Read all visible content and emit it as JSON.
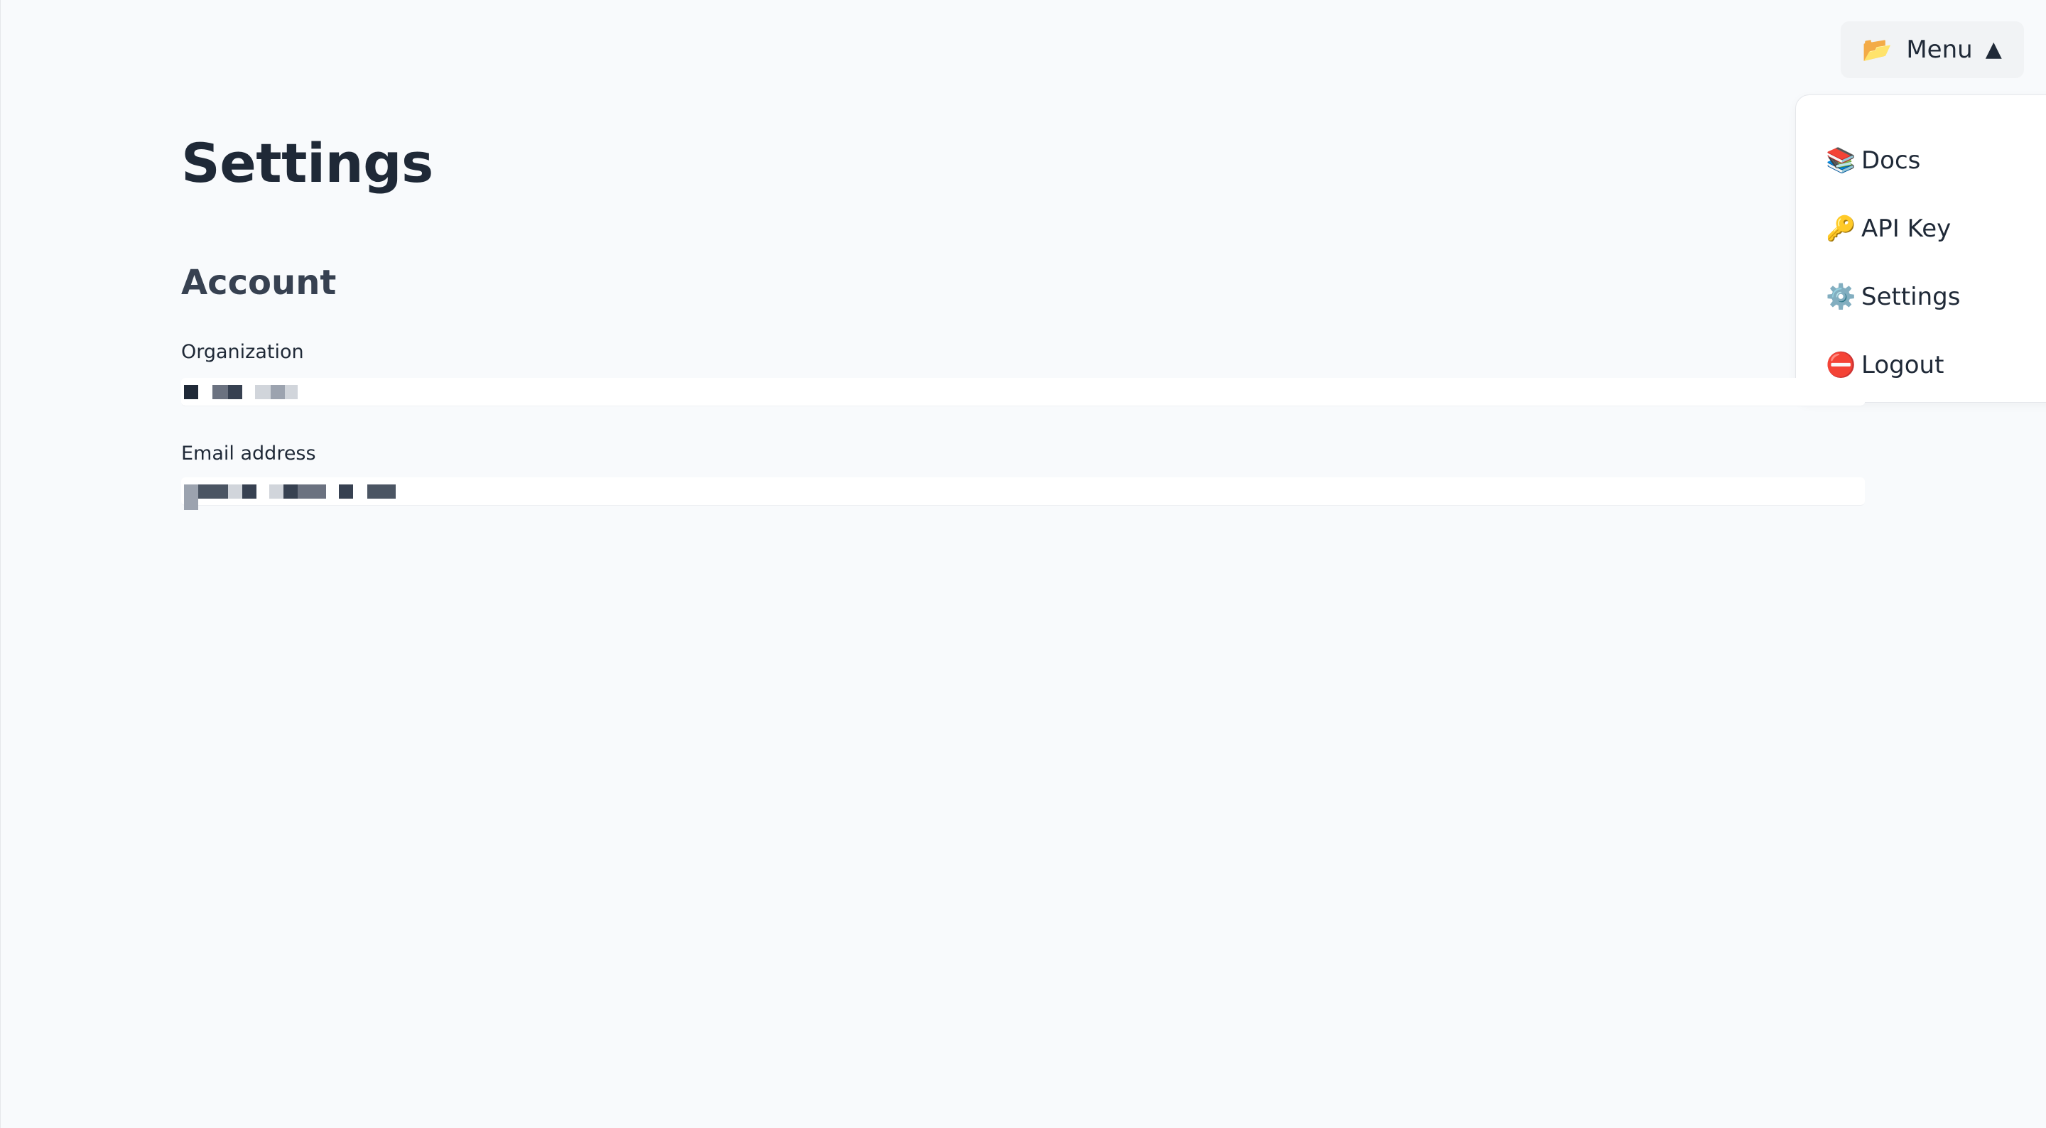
{
  "header": {
    "menu_icon": "folder-open-icon",
    "menu_icon_glyph": "📂",
    "menu_label": "Menu",
    "menu_caret_glyph": "▲"
  },
  "dropdown": {
    "items": [
      {
        "icon": "books-icon",
        "glyph": "📚",
        "label": "Docs"
      },
      {
        "icon": "key-icon",
        "glyph": "🔑",
        "label": "API Key"
      },
      {
        "icon": "gear-icon",
        "glyph": "⚙️",
        "label": "Settings"
      },
      {
        "icon": "no-entry-icon",
        "glyph": "⛔",
        "label": "Logout"
      }
    ]
  },
  "main": {
    "title": "Settings",
    "section_title": "Account",
    "fields": [
      {
        "label": "Organization"
      },
      {
        "label": "Email address"
      }
    ]
  },
  "colors": {
    "background": "#f8fafc",
    "text": "#1f2937",
    "button_bg": "#f1f3f5"
  }
}
